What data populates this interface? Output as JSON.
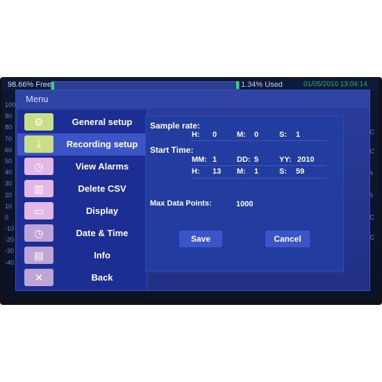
{
  "status": {
    "free": "98.66% Free",
    "used": "1.34% Used",
    "datetime": "01/05/2010 13:04:14",
    "used_fraction": 0.0134
  },
  "y_axis": [
    "100",
    "90",
    "80",
    "70",
    "60",
    "50",
    "40",
    "30",
    "20",
    "10",
    "0",
    "-10",
    "-20",
    "-30",
    "-40"
  ],
  "right_units": [
    "°C",
    "°C",
    "%",
    "%",
    "°C",
    "°C"
  ],
  "menu": {
    "title": "Menu",
    "items": [
      {
        "label": "General setup",
        "icon": "gear-icon",
        "color": "#c9df86"
      },
      {
        "label": "Recording setup",
        "icon": "download-icon",
        "color": "#c9df86"
      },
      {
        "label": "View Alarms",
        "icon": "clock-icon",
        "color": "#e3b7e6"
      },
      {
        "label": "Delete CSV",
        "icon": "trash-icon",
        "color": "#e3b7e6"
      },
      {
        "label": "Display",
        "icon": "monitor-icon",
        "color": "#e3b7e6"
      },
      {
        "label": "Date & Time",
        "icon": "clock-icon",
        "color": "#bfa4d8"
      },
      {
        "label": "Info",
        "icon": "document-icon",
        "color": "#bfa4d8"
      },
      {
        "label": "Back",
        "icon": "close-icon",
        "color": "#bfa4d8"
      }
    ],
    "selected_index": 1
  },
  "recording": {
    "sample_rate_label": "Sample rate:",
    "start_time_label": "Start Time:",
    "sample": {
      "h_label": "H:",
      "h": "0",
      "m_label": "M:",
      "m": "0",
      "s_label": "S:",
      "s": "1"
    },
    "start": {
      "mm_label": "MM:",
      "mm": "1",
      "dd_label": "DD:",
      "dd": "5",
      "yy_label": "YY:",
      "yy": "2010",
      "h_label": "H:",
      "h": "13",
      "m_label": "M:",
      "m": "1",
      "s_label": "S:",
      "s": "59"
    },
    "max_points_label": "Max Data Points:",
    "max_points": "1000",
    "save_label": "Save",
    "cancel_label": "Cancel"
  }
}
